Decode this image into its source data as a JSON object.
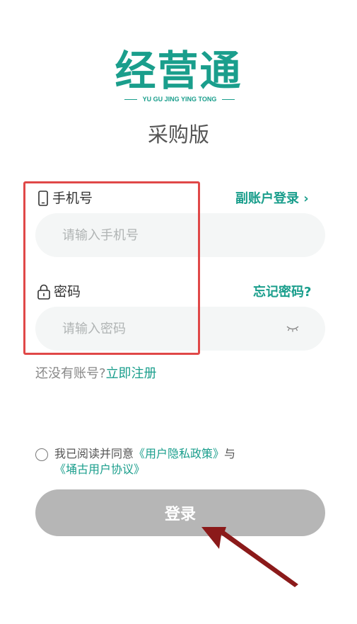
{
  "logo": {
    "title": "经营通",
    "subtitle": "YU GU JING YING TONG"
  },
  "edition": "采购版",
  "phone": {
    "label": "手机号",
    "placeholder": "请输入手机号",
    "sub_account_link": "副账户登录 ›"
  },
  "password": {
    "label": "密码",
    "placeholder": "请输入密码",
    "forgot_link": "忘记密码?"
  },
  "register": {
    "prompt": "还没有账号?",
    "link": "立即注册"
  },
  "agreement": {
    "prefix": "我已阅读并同意",
    "privacy_link": "《用户隐私政策》",
    "and": "与",
    "terms_link": "《埇古用户协议》"
  },
  "login_button": "登录",
  "colors": {
    "accent": "#1a9e8c",
    "highlight": "#e04848",
    "arrow": "#8b1a1a",
    "button_disabled": "#b6b6b6"
  },
  "icons": {
    "phone": "phone-icon",
    "lock": "lock-icon",
    "eye": "eye-closed-icon",
    "radio": "radio-unchecked-icon"
  }
}
